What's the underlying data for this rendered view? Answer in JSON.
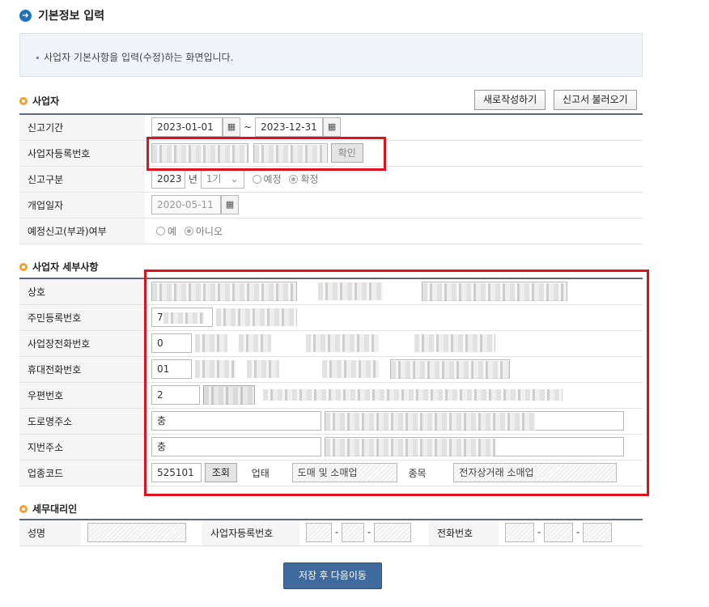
{
  "page": {
    "title": "기본정보 입력",
    "notice": "사업자 기본사항을 입력(수정)하는 화면입니다."
  },
  "business": {
    "section_title": "사업자",
    "new_button": "새로작성하기",
    "load_button": "신고서 불러오기",
    "period_label": "신고기간",
    "period_start": "2023-01-01",
    "period_end": "2023-12-31",
    "tilde": "~",
    "reg_no_label": "사업자등록번호",
    "confirm_button": "확인",
    "type_label": "신고구분",
    "year": "2023",
    "year_unit": "년",
    "term": "1기",
    "opt_planned": "예정",
    "opt_final": "확정",
    "open_date_label": "개업일자",
    "open_date": "2020-05-11",
    "planned_tax_label": "예정신고(부과)여부",
    "opt_yes": "예",
    "opt_no": "아니오"
  },
  "details": {
    "section_title": "사업자 세부사항",
    "rows": [
      {
        "label": "상호"
      },
      {
        "label": "주민등록번호",
        "prefix": "7"
      },
      {
        "label": "사업장전화번호",
        "prefix": "0"
      },
      {
        "label": "휴대전화번호",
        "prefix": "01"
      },
      {
        "label": "우편번호",
        "prefix": "2"
      },
      {
        "label": "도로명주소",
        "prefix": "충"
      },
      {
        "label": "지번주소",
        "prefix": "충"
      },
      {
        "label": "업종코드"
      }
    ],
    "industry_code": "525101",
    "lookup_button": "조회",
    "business_type_label": "업태",
    "business_type": "도매 및 소매업",
    "item_label": "종목",
    "item": "전자상거래 소매업"
  },
  "agent": {
    "section_title": "세무대리인",
    "name_label": "성명",
    "reg_no_label": "사업자등록번호",
    "phone_label": "전화번호",
    "dash": "-"
  },
  "footer": {
    "save_button": "저장 후 다음이동"
  },
  "colors": {
    "highlight": "#e0101c",
    "primary": "#3e6a9e",
    "section_bullet": "#f0a030"
  }
}
